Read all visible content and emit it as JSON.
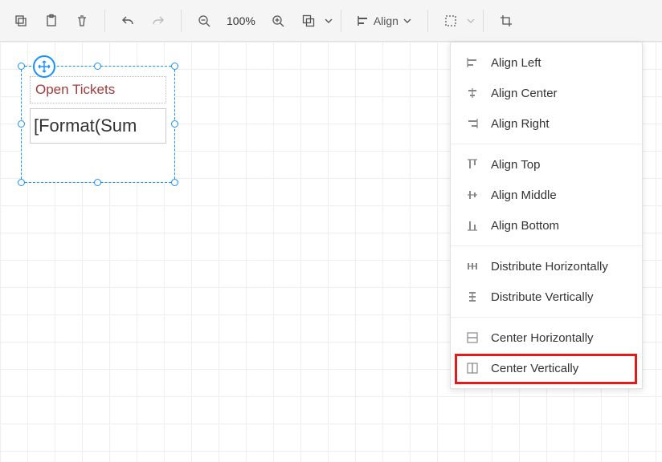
{
  "toolbar": {
    "zoom_text": "100%",
    "align_label": "Align"
  },
  "canvas": {
    "tickets_text": "Open Tickets",
    "format_text": "[Format(Sum"
  },
  "dropdown": {
    "items": [
      {
        "label": "Align Left"
      },
      {
        "label": "Align Center"
      },
      {
        "label": "Align Right"
      },
      {
        "label": "Align Top"
      },
      {
        "label": "Align Middle"
      },
      {
        "label": "Align Bottom"
      },
      {
        "label": "Distribute Horizontally"
      },
      {
        "label": "Distribute Vertically"
      },
      {
        "label": "Center Horizontally"
      },
      {
        "label": "Center Vertically"
      }
    ]
  }
}
